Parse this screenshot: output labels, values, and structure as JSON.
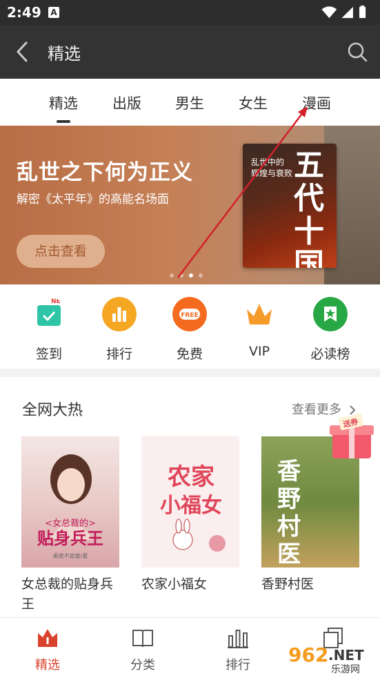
{
  "status": {
    "time": "2:49",
    "notification_icon": "A"
  },
  "header": {
    "title": "精选"
  },
  "tabs": [
    {
      "label": "精选"
    },
    {
      "label": "出版"
    },
    {
      "label": "男生"
    },
    {
      "label": "女生"
    },
    {
      "label": "漫画"
    }
  ],
  "banner": {
    "title": "乱世之下何为正义",
    "subtitle": "解密《太平年》的高能名场面",
    "button": "点击查看",
    "cover_line1": "乱世中的",
    "cover_line2": "辉煌与衰败",
    "cover_big": "五代十国",
    "slides": 4,
    "active_slide": 3
  },
  "quick": [
    {
      "label": "签到",
      "icon": "calendar-check-icon",
      "badge": "NEW",
      "color": "#2ec4a6"
    },
    {
      "label": "排行",
      "icon": "bar-chart-icon",
      "color": "#f5a623"
    },
    {
      "label": "免费",
      "icon": "free-icon",
      "badge": "FREE",
      "color": "#f46a1f"
    },
    {
      "label": "VIP",
      "icon": "crown-icon",
      "color": "#f59b2a"
    },
    {
      "label": "必读榜",
      "icon": "star-bookmark-icon",
      "color": "#27a844"
    }
  ],
  "hot": {
    "title": "全网大热",
    "more": "查看更多",
    "books": [
      {
        "name": "女总裁的贴身兵王",
        "cover_title": "<女总裁的>贴身兵王",
        "cover_author": "黑夜不寂寞/著"
      },
      {
        "name": "农家小福女",
        "cover_title": "农家小福女"
      },
      {
        "name": "香野村医",
        "cover_title": "香野村医",
        "gift": "送券"
      }
    ]
  },
  "nav": [
    {
      "label": "精选",
      "icon": "crown-book-icon"
    },
    {
      "label": "分类",
      "icon": "open-book-icon"
    },
    {
      "label": "排行",
      "icon": "bar-chart-icon"
    },
    {
      "label": "",
      "icon": "stack-icon"
    }
  ],
  "watermark": {
    "text1": "962",
    "text2": ".NET",
    "text3": "乐游网"
  },
  "colors": {
    "accent": "#d9432e",
    "statusbar": "#2d2d2d",
    "titlebar": "#333333"
  }
}
